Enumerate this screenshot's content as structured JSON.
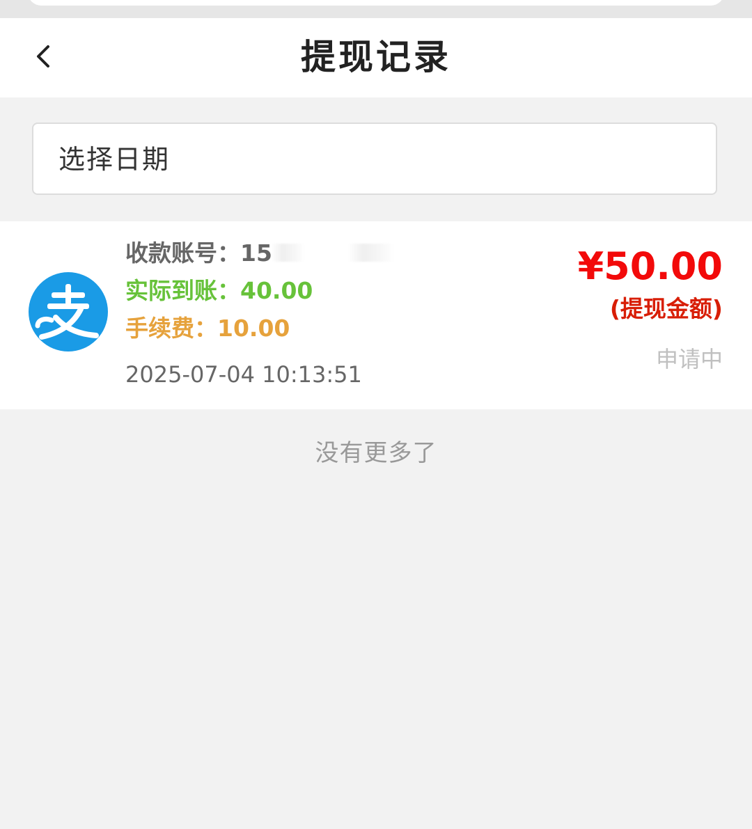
{
  "header": {
    "title": "提现记录",
    "back_icon": "chevron-left-icon"
  },
  "filter": {
    "date_placeholder": "选择日期"
  },
  "records": [
    {
      "payment_icon": "alipay-logo-icon",
      "account_label": "收款账号：",
      "account_value": "15",
      "actual_label": "实际到账：",
      "actual_value": "40.00",
      "fee_label": "手续费：",
      "fee_value": "10.00",
      "time": "2025-07-04 10:13:51",
      "amount": "¥50.00",
      "amount_label": "(提现金额)",
      "status": "申请中"
    }
  ],
  "list": {
    "end_text": "没有更多了"
  },
  "colors": {
    "amount": "#f20a0a",
    "actual": "#67c23a",
    "fee": "#e6a23c",
    "alipay_blue": "#1a9be6"
  }
}
